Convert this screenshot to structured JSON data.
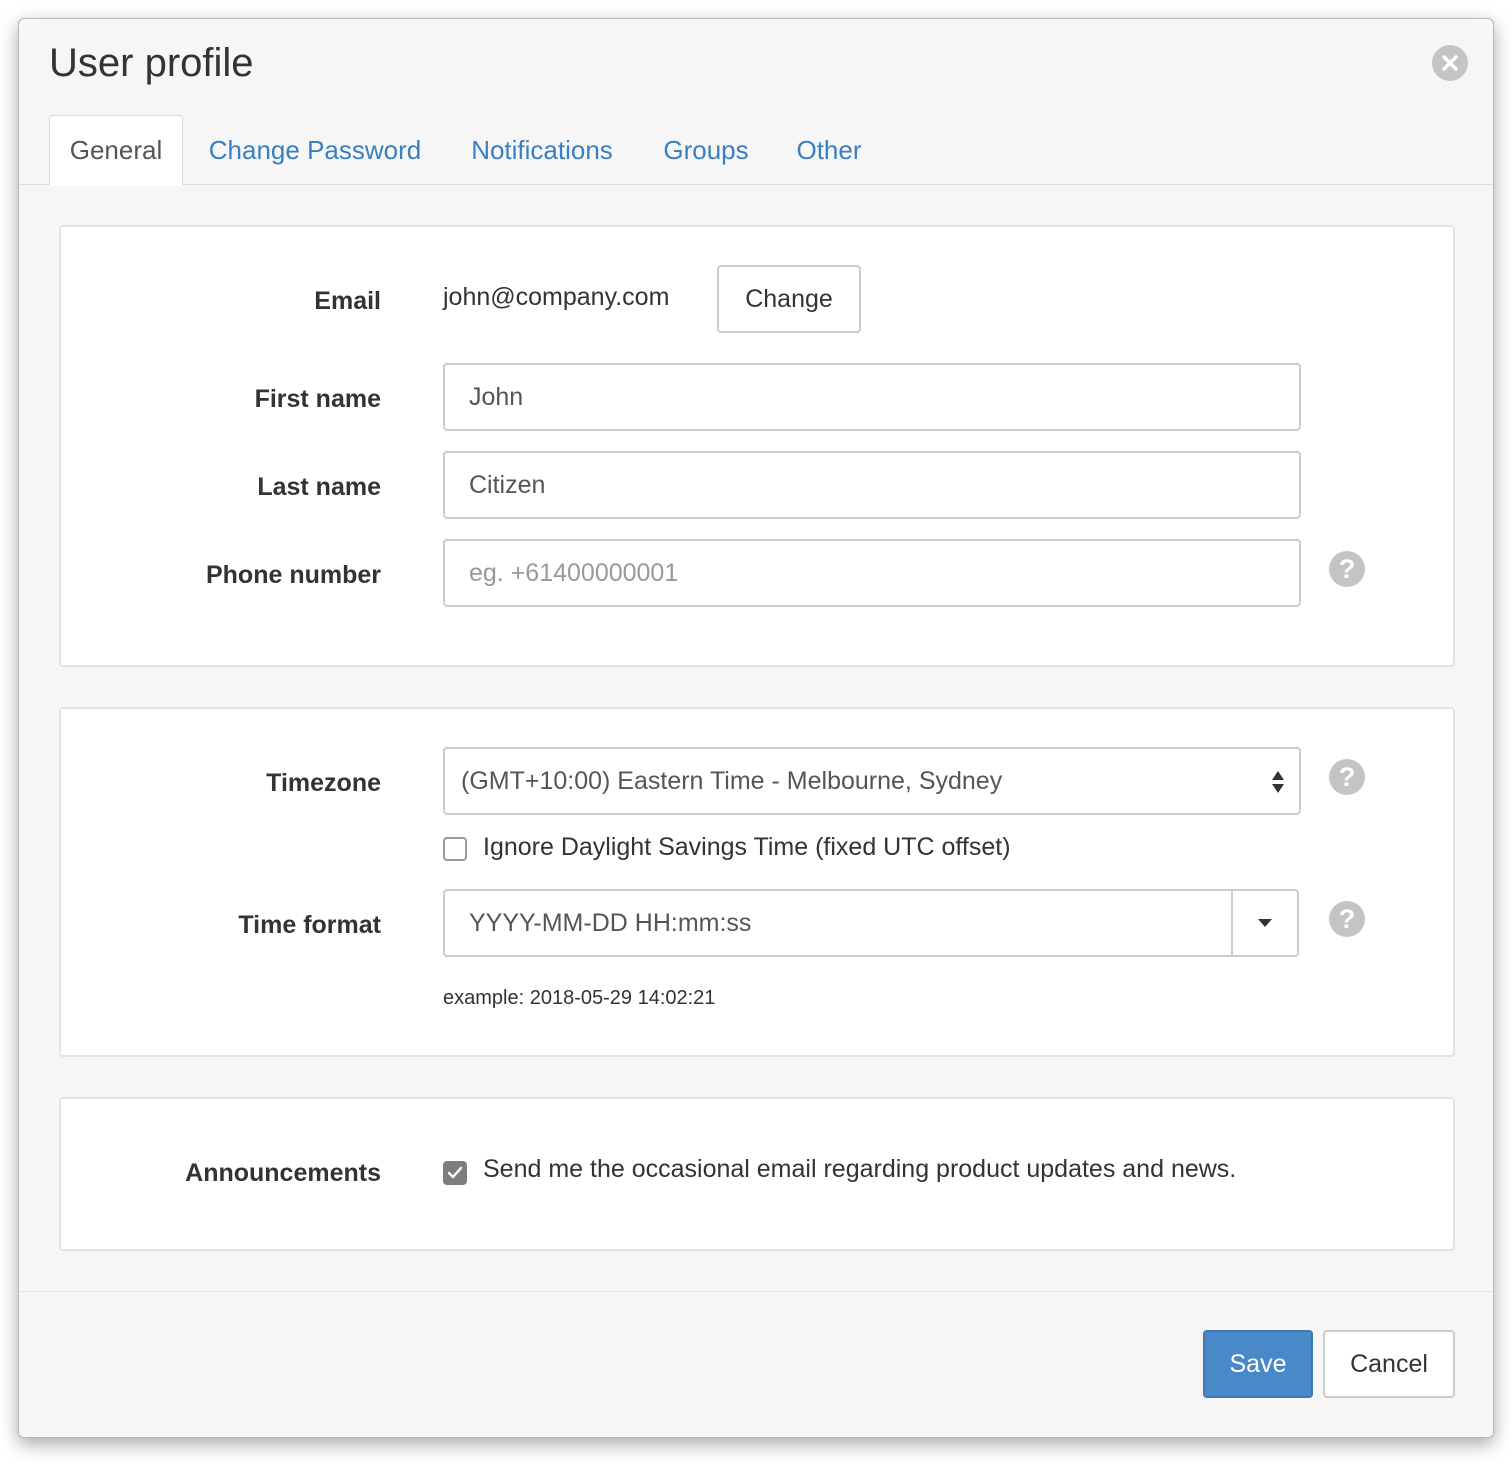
{
  "dialog": {
    "title": "User profile"
  },
  "tabs": [
    {
      "label": "General",
      "active": true
    },
    {
      "label": "Change Password",
      "active": false
    },
    {
      "label": "Notifications",
      "active": false
    },
    {
      "label": "Groups",
      "active": false
    },
    {
      "label": "Other",
      "active": false
    }
  ],
  "account": {
    "email_label": "Email",
    "email_value": "john@company.com",
    "change_label": "Change",
    "first_name_label": "First name",
    "first_name_value": "John",
    "last_name_label": "Last name",
    "last_name_value": "Citizen",
    "phone_label": "Phone number",
    "phone_placeholder": "eg. +61400000001",
    "phone_value": ""
  },
  "time": {
    "timezone_label": "Timezone",
    "timezone_value": "(GMT+10:00) Eastern Time - Melbourne, Sydney",
    "dst_label": "Ignore Daylight Savings Time (fixed UTC offset)",
    "dst_checked": false,
    "format_label": "Time format",
    "format_value": "YYYY-MM-DD HH:mm:ss",
    "example_text": "example: 2018-05-29 14:02:21"
  },
  "announcements": {
    "label": "Announcements",
    "checkbox_label": "Send me the occasional email regarding product updates and news.",
    "checked": true
  },
  "footer": {
    "save_label": "Save",
    "cancel_label": "Cancel"
  },
  "icons": {
    "close": "close-icon",
    "help": "question-circle-icon",
    "select_arrows": "sort-arrows-icon",
    "dropdown_caret": "caret-down-icon",
    "check": "check-icon"
  },
  "colors": {
    "accent": "#3a7fbf",
    "primary_button": "#4a89c8",
    "icon_gray": "#c4c4c4"
  }
}
